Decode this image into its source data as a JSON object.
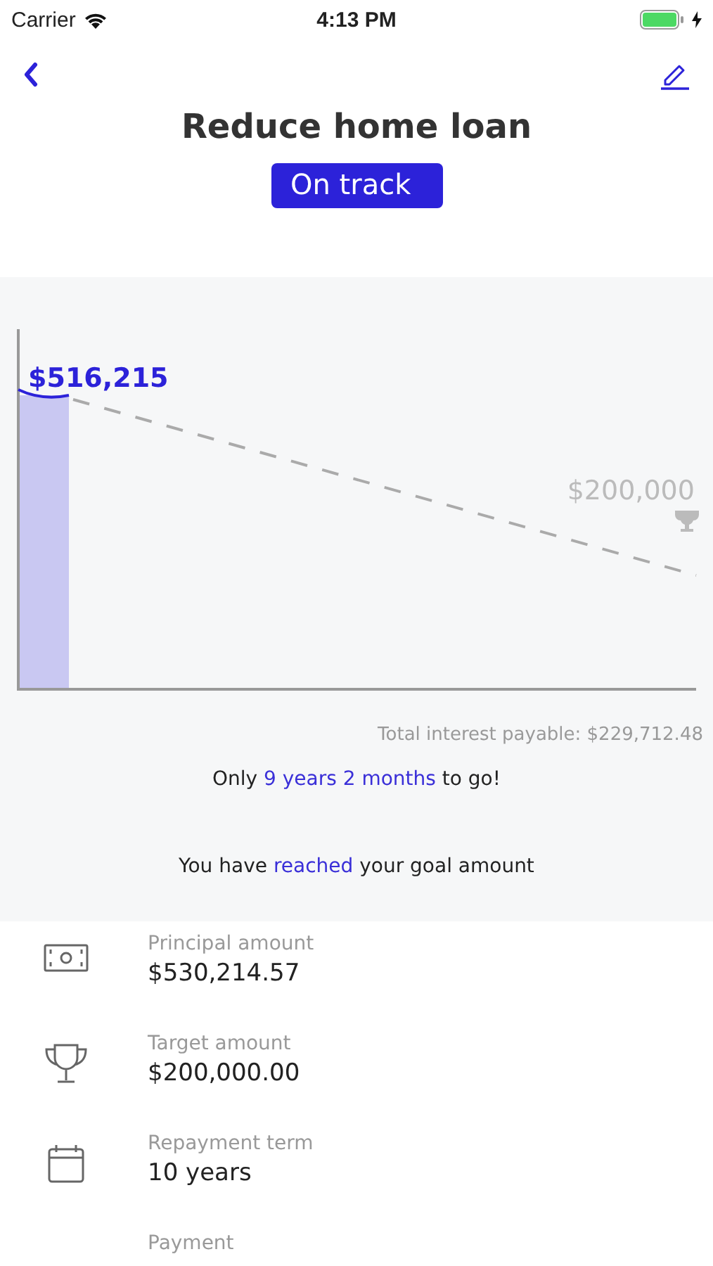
{
  "status_bar": {
    "carrier": "Carrier",
    "time": "4:13 PM",
    "battery_charging": true
  },
  "header": {
    "title": "Reduce home loan",
    "status_badge": "On track"
  },
  "chart": {
    "current_label": "$516,215",
    "target_label": "$200,000"
  },
  "summary": {
    "total_interest": "Total interest payable: $229,712.48",
    "time_left": "Only **9 years 2 months** to go!",
    "goal_message": "You have **reached** your goal amount"
  },
  "details": [
    {
      "kind": "cash",
      "label": "Principal amount",
      "value": "$530,214.57"
    },
    {
      "kind": "trophy",
      "label": "Target amount",
      "value": "$200,000.00"
    },
    {
      "kind": "calendar",
      "label": "Repayment term",
      "value": "10 years"
    },
    {
      "kind": "none",
      "label": "Payment"
    }
  ]
}
